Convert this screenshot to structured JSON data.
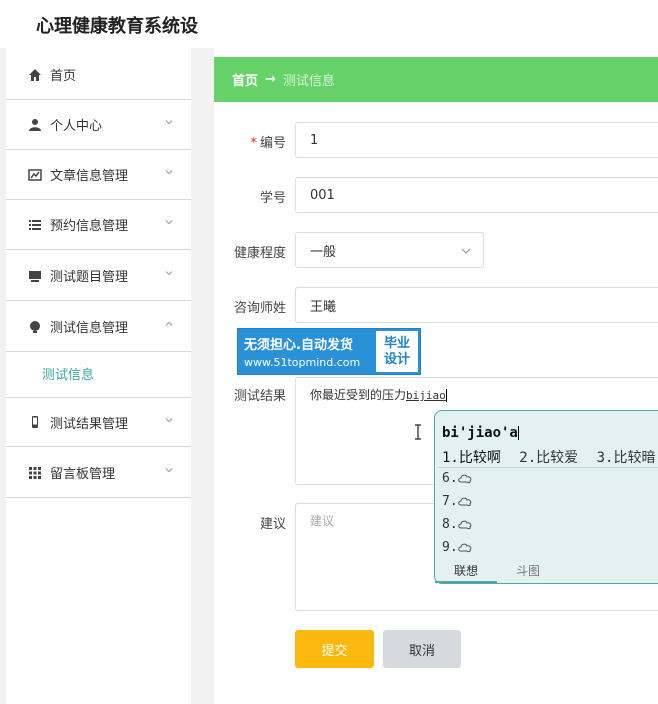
{
  "app": {
    "title": "心理健康教育系统设"
  },
  "sidebar": {
    "items": [
      {
        "label": "首页",
        "icon": "home-icon",
        "expanded": null
      },
      {
        "label": "个人中心",
        "icon": "user-icon",
        "expanded": false
      },
      {
        "label": "文章信息管理",
        "icon": "chart-icon",
        "expanded": false
      },
      {
        "label": "预约信息管理",
        "icon": "list-icon",
        "expanded": false
      },
      {
        "label": "测试题目管理",
        "icon": "desktop-icon",
        "expanded": false
      },
      {
        "label": "测试信息管理",
        "icon": "lightbulb-icon",
        "expanded": true
      },
      {
        "label": "测试结果管理",
        "icon": "mobile-icon",
        "expanded": false
      },
      {
        "label": "留言板管理",
        "icon": "grid-icon",
        "expanded": false
      }
    ],
    "subitem": {
      "label": "测试信息"
    },
    "accent_color": "#3aa6a0"
  },
  "breadcrumb": {
    "home": "首页",
    "arrow": "→",
    "current": "测试信息",
    "bg_color": "#67d26a"
  },
  "form": {
    "bianhao": {
      "label": "编号",
      "required_mark": "*",
      "value": "1"
    },
    "xuehao": {
      "label": "学号",
      "value": "001"
    },
    "jiankang": {
      "label": "健康程度",
      "value": "一般"
    },
    "zixunshi": {
      "label": "咨询师姓",
      "value": "王曦"
    },
    "ceshijieguo": {
      "label": "测试结果",
      "value": "你最近受到的压力",
      "composing": "bijiao"
    },
    "jianyi": {
      "label": "建议",
      "placeholder": "建议"
    }
  },
  "ad": {
    "line1": "无须担心.自动发货",
    "line2": "www.51topmind.com",
    "right1": "毕业",
    "right2": "设计"
  },
  "ime": {
    "composition": "bi'jiao'a",
    "candidates": [
      "1.比较啊",
      "2.比较爱",
      "3.比较暗"
    ],
    "empty_slots": [
      "6.",
      "7.",
      "8.",
      "9."
    ],
    "tabs": [
      "联想",
      "斗图"
    ],
    "bg_color": "#e3f2f1"
  },
  "buttons": {
    "submit": "提交",
    "cancel": "取消",
    "submit_color": "#fbb80f",
    "cancel_color": "#d6d9dd"
  }
}
